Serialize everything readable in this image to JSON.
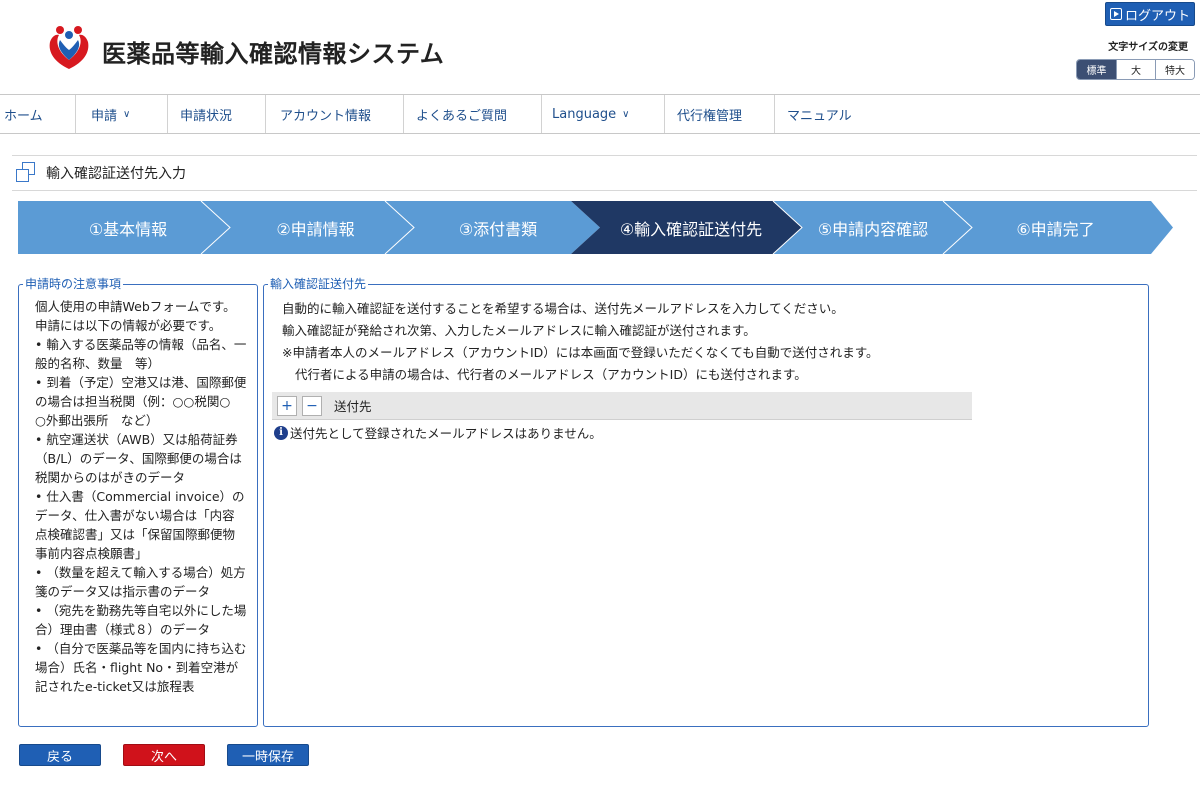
{
  "header": {
    "title": "医薬品等輸入確認情報システム",
    "logout_label": "ログアウト",
    "fontsize_label": "文字サイズの変更",
    "fontsize_options": [
      "標準",
      "大",
      "特大"
    ]
  },
  "nav": {
    "items": [
      {
        "label": "ホーム"
      },
      {
        "label": "申請",
        "chevron": "∨"
      },
      {
        "label": "申請状況"
      },
      {
        "label": "アカウント情報"
      },
      {
        "label": "よくあるご質問"
      },
      {
        "label": "Language",
        "chevron": "∨"
      },
      {
        "label": "代行権管理"
      },
      {
        "label": "マニュアル"
      }
    ]
  },
  "page": {
    "title": "輸入確認証送付先入力"
  },
  "steps": {
    "items": [
      "①基本情報",
      "②申請情報",
      "③添付書類",
      "④輸入確認証送付先",
      "⑤申請内容確認",
      "⑥申請完了"
    ],
    "active_index": 3,
    "colors": {
      "inactive": "#5b9bd5",
      "active": "#1f3864"
    }
  },
  "notice": {
    "legend": "申請時の注意事項",
    "lines": [
      "個人使用の申請Webフォームです。",
      "申請には以下の情報が必要です。",
      "• 輸入する医薬品等の情報（品名、一",
      "般的名称、数量　等）",
      "• 到着（予定）空港又は港、国際郵便",
      "の場合は担当税関（例：○○税関○",
      "○外郵出張所　など）",
      "• 航空運送状（AWB）又は船荷証券",
      "（B/L）のデータ、国際郵便の場合は",
      "税関からのはがきのデータ",
      "• 仕入書（Commercial invoice）の",
      "データ、仕入書がない場合は「内容",
      "点検確認書」又は「保留国際郵便物",
      "事前内容点検願書」",
      "• （数量を超えて輸入する場合）処方",
      "箋のデータ又は指示書のデータ",
      "• （宛先を勤務先等自宅以外にした場",
      "合）理由書（様式８）のデータ",
      "• （自分で医薬品等を国内に持ち込む",
      "場合）氏名・flight No・到着空港が",
      "記されたe-ticket又は旅程表"
    ]
  },
  "destination": {
    "legend": "輸入確認証送付先",
    "line1": "自動的に輸入確認証を送付することを希望する場合は、送付先メールアドレスを入力してください。",
    "line2": "輸入確認証が発給され次第、入力したメールアドレスに輸入確認証が送付されます。",
    "line3": "※申請者本人のメールアドレス（アカウントID）には本画面で登録いただくなくても自動で送付されます。",
    "line4": "代行者による申請の場合は、代行者のメールアドレス（アカウントID）にも送付されます。",
    "add_label": "+",
    "remove_label": "−",
    "column_label": "送付先",
    "empty_message": "送付先として登録されたメールアドレスはありません。"
  },
  "buttons": {
    "back": "戻る",
    "next": "次へ",
    "save": "一時保存"
  }
}
